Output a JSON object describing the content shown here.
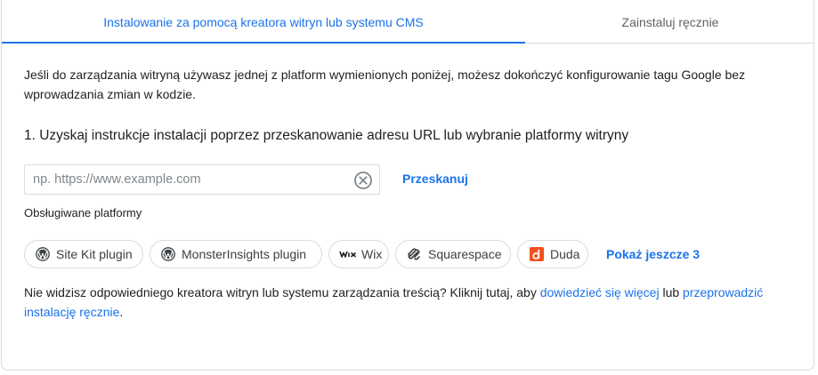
{
  "tabs": [
    {
      "label": "Instalowanie za pomocą kreatora witryn lub systemu CMS",
      "active": true
    },
    {
      "label": "Zainstaluj ręcznie",
      "active": false
    }
  ],
  "intro_text": "Jeśli do zarządzania witryną używasz jednej z platform wymienionych poniżej, możesz dokończyć konfigurowanie tagu Google bez wprowadzania zmian w kodzie.",
  "step1_text": "1. Uzyskaj instrukcje instalacji poprzez przeskanowanie adresu URL lub wybranie platformy witryny",
  "url_input": {
    "value": "",
    "placeholder": "np. https://www.example.com"
  },
  "scan_label": "Przeskanuj",
  "platforms_label": "Obsługiwane platformy",
  "platforms": [
    {
      "label": "Site Kit plugin",
      "icon": "wordpress-icon"
    },
    {
      "label": "MonsterInsights plugin",
      "icon": "wordpress-icon"
    },
    {
      "label": "Wix",
      "icon": "wix-icon"
    },
    {
      "label": "Squarespace",
      "icon": "squarespace-icon"
    },
    {
      "label": "Duda",
      "icon": "duda-icon"
    }
  ],
  "show_more_label": "Pokaż jeszcze 3",
  "footer": {
    "text_before": "Nie widzisz odpowiedniego kreatora witryn lub systemu zarządzania treścią? Kliknij tutaj, aby ",
    "link_learn_more": "dowiedzieć się więcej",
    "text_middle": " lub ",
    "link_manual": "przeprowadzić instalację ręcznie",
    "text_after": "."
  },
  "colors": {
    "accent": "#1a73e8",
    "duda": "#f4511e"
  }
}
